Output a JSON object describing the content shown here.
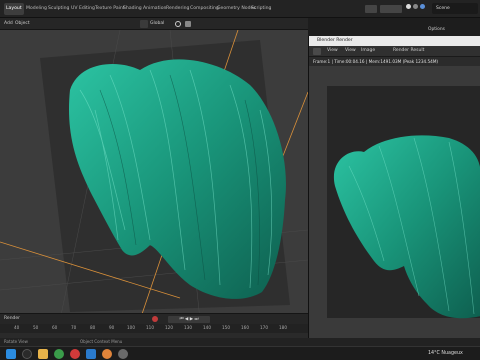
{
  "workspace_tabs": [
    "Layout",
    "Modeling",
    "Sculpting",
    "UV Editing",
    "Texture Paint",
    "Shading",
    "Animation",
    "Rendering",
    "Compositing",
    "Geometry Nodes",
    "Scripting"
  ],
  "active_tab": "Layout",
  "scene_name": "Scene",
  "options_label": "Options",
  "viewport_header": {
    "add": "Add",
    "object": "Object",
    "transform": "Global"
  },
  "render_window": {
    "title": "Blender Render",
    "menus": [
      "View",
      "View",
      "Image"
    ],
    "slot": "Render Result",
    "info": "Frame:1 | Time:00:04.16 | Mem:1491.03M (Peak 1234.54M)"
  },
  "timeline": {
    "label": "Render",
    "ticks": [
      "40",
      "50",
      "60",
      "70",
      "80",
      "90",
      "100",
      "110",
      "120",
      "130",
      "140",
      "150",
      "160",
      "170",
      "180"
    ]
  },
  "status_text": "Object Context Menu",
  "status_left": "Rotate View",
  "taskbar": {
    "weather": "14°C  Nuageux",
    "icons": [
      "windows-icon",
      "search-icon",
      "file-explorer-icon",
      "chrome-icon",
      "opera-icon",
      "vscode-icon",
      "blender-icon",
      "settings-icon"
    ]
  },
  "colors": {
    "hair": "#1fa58a",
    "hair_light": "#5ad6bc",
    "accent": "#e8a24c"
  }
}
